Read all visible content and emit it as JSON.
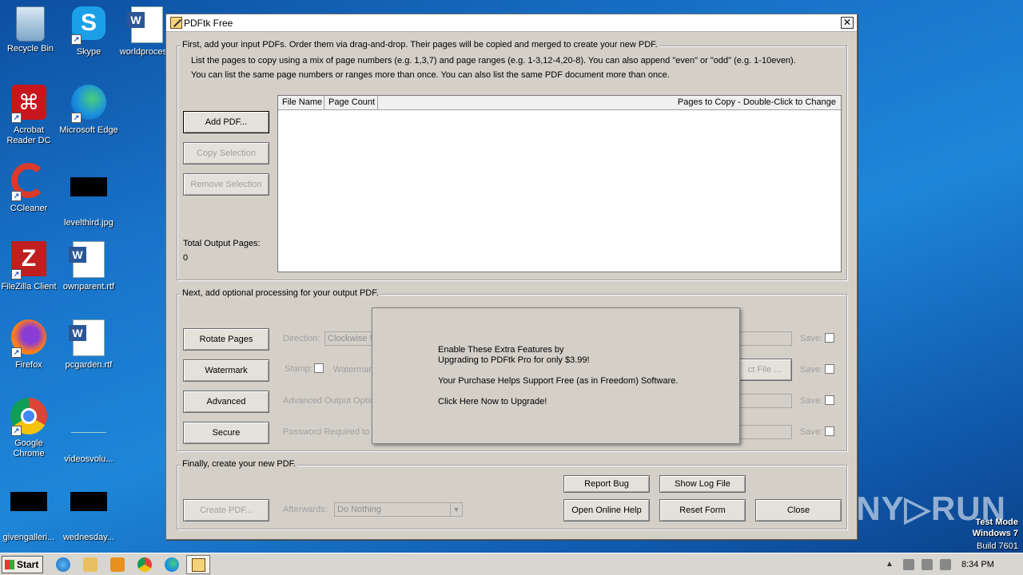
{
  "desktop": {
    "icons": [
      {
        "label": "Recycle Bin"
      },
      {
        "label": "Skype"
      },
      {
        "label": "worldproces..."
      },
      {
        "label": "Acrobat Reader DC"
      },
      {
        "label": "Microsoft Edge"
      },
      {
        "label": "CCleaner"
      },
      {
        "label": "levelthird.jpg"
      },
      {
        "label": "FileZilla Client"
      },
      {
        "label": "ownparent.rtf"
      },
      {
        "label": "Firefox"
      },
      {
        "label": "pcgarden.rtf"
      },
      {
        "label": "Google Chrome"
      },
      {
        "label": "videosvolu..."
      },
      {
        "label": "givengalleri..."
      },
      {
        "label": "wednesday..."
      }
    ]
  },
  "window": {
    "title": "PDFtk Free",
    "close_glyph": "✕",
    "input_group": {
      "legend": "First, add your input PDFs. Order them via drag-and-drop. Their pages will be copied and merged to create your new PDF.",
      "help1": "List the pages to copy using a mix of page numbers (e.g. 1,3,7) and page ranges (e.g. 1-3,12-4,20-8). You can also append \"even\" or \"odd\" (e.g. 1-10even).",
      "help2": "You can list the same page numbers or ranges more than once. You can also list the same PDF document more than once.",
      "add_pdf": "Add PDF...",
      "copy_selection": "Copy Selection",
      "remove_selection": "Remove Selection",
      "total_label": "Total Output Pages:",
      "total_value": "0",
      "columns": [
        "File Name",
        "Page Count",
        "Pages to Copy - Double-Click to Change"
      ]
    },
    "processing_group": {
      "legend": "Next, add optional processing for your output PDF.",
      "rotate": "Rotate Pages",
      "direction_label": "Direction:",
      "direction_value": "Clockwise 9",
      "watermark": "Watermark",
      "stamp_label": "Stamp:",
      "watermark_label": "Watermar",
      "select_file": "ct File ...",
      "advanced": "Advanced",
      "advanced_label": "Advanced Output Optio",
      "secure": "Secure",
      "password_label": "Password Required to O",
      "save_label": "Save:"
    },
    "popup": {
      "line1": "Enable These Extra Features by",
      "line2": "Upgrading to PDFtk Pro for only $3.99!",
      "line3": "Your Purchase Helps Support Free (as in Freedom) Software.",
      "line4": "Click Here Now to Upgrade!"
    },
    "create_group": {
      "legend": "Finally, create your new PDF.",
      "report_bug": "Report Bug",
      "show_log": "Show Log File",
      "create_pdf": "Create PDF...",
      "afterwards_label": "Afterwards:",
      "afterwards_value": "Do Nothing",
      "online_help": "Open Online Help",
      "reset_form": "Reset Form",
      "close": "Close"
    }
  },
  "overlay": {
    "watermark": "ANY▷RUN",
    "test_mode": "Test Mode",
    "windows": "Windows 7",
    "build": "Build 7601"
  },
  "taskbar": {
    "start": "Start",
    "clock": "8:34 PM"
  }
}
